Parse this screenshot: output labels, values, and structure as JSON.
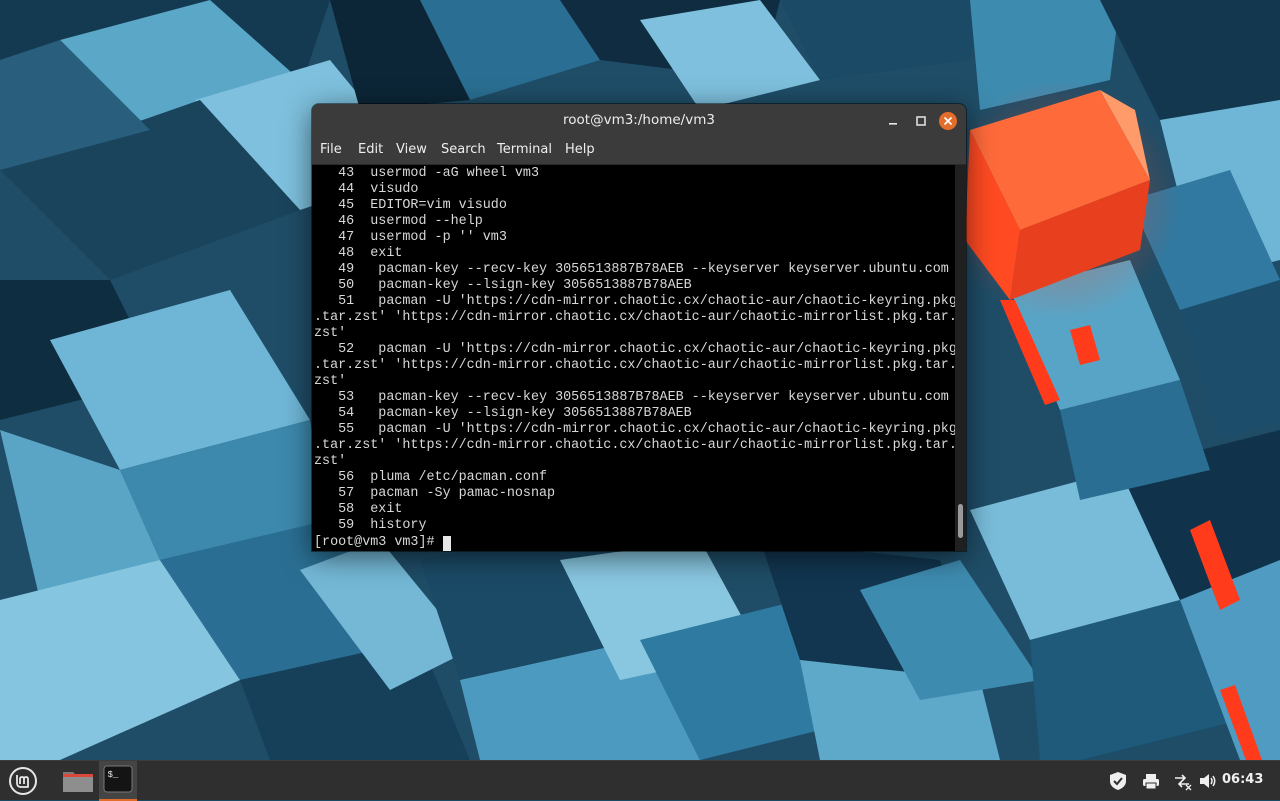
{
  "window": {
    "title": "root@vm3:/home/vm3",
    "menu": [
      "File",
      "Edit",
      "View",
      "Search",
      "Terminal",
      "Help"
    ],
    "buttons": [
      "minimize-icon",
      "maximize-icon",
      "close-icon"
    ]
  },
  "terminal": {
    "lines": [
      "   43  usermod -aG wheel vm3",
      "   44  visudo",
      "   45  EDITOR=vim visudo",
      "   46  usermod --help",
      "   47  usermod -p '' vm3",
      "   48  exit",
      "   49   pacman-key --recv-key 3056513887B78AEB --keyserver keyserver.ubuntu.com",
      "   50   pacman-key --lsign-key 3056513887B78AEB",
      "   51   pacman -U 'https://cdn-mirror.chaotic.cx/chaotic-aur/chaotic-keyring.pkg",
      ".tar.zst' 'https://cdn-mirror.chaotic.cx/chaotic-aur/chaotic-mirrorlist.pkg.tar.",
      "zst'",
      "   52   pacman -U 'https://cdn-mirror.chaotic.cx/chaotic-aur/chaotic-keyring.pkg",
      ".tar.zst' 'https://cdn-mirror.chaotic.cx/chaotic-aur/chaotic-mirrorlist.pkg.tar.",
      "zst'",
      "   53   pacman-key --recv-key 3056513887B78AEB --keyserver keyserver.ubuntu.com",
      "   54   pacman-key --lsign-key 3056513887B78AEB",
      "   55   pacman -U 'https://cdn-mirror.chaotic.cx/chaotic-aur/chaotic-keyring.pkg",
      ".tar.zst' 'https://cdn-mirror.chaotic.cx/chaotic-aur/chaotic-mirrorlist.pkg.tar.",
      "zst'",
      "   56  pluma /etc/pacman.conf",
      "   57  pacman -Sy pamac-nosnap",
      "   58  exit",
      "   59  history"
    ],
    "prompt": "[root@vm3 vm3]# ",
    "scroll_position": 0.97
  },
  "taskbar": {
    "launchers": [
      "mint-menu-icon",
      "files-icon",
      "terminal-icon"
    ],
    "tray": [
      "shield-icon",
      "printer-icon",
      "network-icon",
      "volume-icon"
    ],
    "clock": "06:43"
  },
  "colors": {
    "titlebar": "#3b3b3b",
    "terminal_bg": "#000000",
    "terminal_fg": "#d8d8d8",
    "close_button": "#e36d2b",
    "panel": "#2f2f2f",
    "accent": "#e36d2b"
  }
}
